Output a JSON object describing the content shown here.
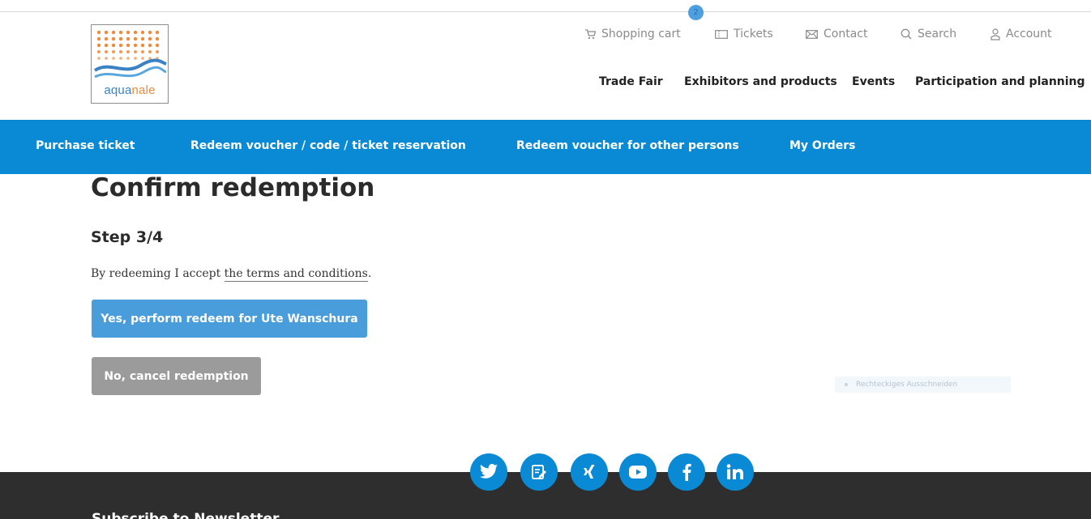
{
  "header": {
    "cart_count": "2",
    "logo": {
      "text_part1": "aqua",
      "text_part2": "nale"
    },
    "utility_nav": [
      {
        "label": "Shopping cart",
        "icon": "cart-icon"
      },
      {
        "label": "Tickets",
        "icon": "ticket-icon"
      },
      {
        "label": "Contact",
        "icon": "envelope-icon"
      },
      {
        "label": "Search",
        "icon": "search-icon"
      },
      {
        "label": "Account",
        "icon": "user-icon"
      }
    ],
    "main_nav": [
      "Trade Fair",
      "Exhibitors and products",
      "Events",
      "Participation and planning"
    ]
  },
  "subnav": [
    "Purchase ticket",
    "Redeem voucher / code / ticket reservation",
    "Redeem voucher for other persons",
    "My Orders"
  ],
  "main": {
    "title": "Confirm redemption",
    "step": "Step 3/4",
    "terms_prefix": "By redeeming I accept ",
    "terms_link": "the terms and conditions",
    "terms_suffix": ".",
    "yes_button": "Yes, perform redeem for Ute Wanschura",
    "no_button": "No, cancel redemption"
  },
  "overlay": {
    "label": "Rechteckiges Ausschneiden"
  },
  "footer": {
    "social": [
      "twitter-icon",
      "blog-icon",
      "xing-icon",
      "youtube-icon",
      "facebook-icon",
      "linkedin-icon"
    ],
    "newsletter_heading": "Subscribe to Newsletter"
  },
  "colors": {
    "brand_blue": "#0a8ad4",
    "button_blue": "#4a9ddb",
    "button_gray": "#9b9b9b",
    "footer_bg": "#2e2e2e",
    "logo_orange": "#f08a3c"
  }
}
